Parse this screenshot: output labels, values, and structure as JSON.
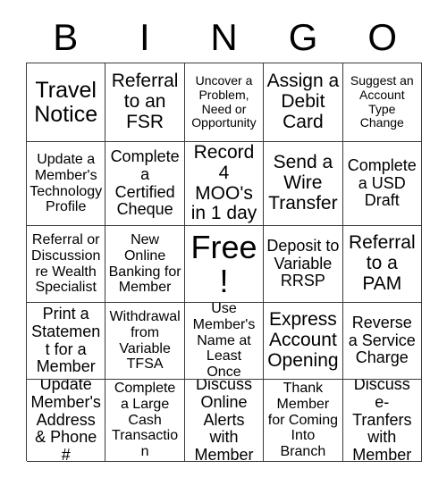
{
  "card": {
    "header_letters": [
      "B",
      "I",
      "N",
      "G",
      "O"
    ],
    "rows": [
      [
        {
          "text": "Travel Notice",
          "size": "fs-xl"
        },
        {
          "text": "Referral to an FSR",
          "size": "fs-lg"
        },
        {
          "text": "Uncover a Problem, Need or Opportunity",
          "size": "fs-xs"
        },
        {
          "text": "Assign a Debit Card",
          "size": "fs-lg"
        },
        {
          "text": "Suggest an Account Type Change",
          "size": "fs-xs"
        }
      ],
      [
        {
          "text": "Update a Member's Technology Profile",
          "size": "fs-sm"
        },
        {
          "text": "Complete a Certified Cheque",
          "size": "fs-md"
        },
        {
          "text": "Record 4 MOO's in 1 day",
          "size": "fs-lg"
        },
        {
          "text": "Send a Wire Transfer",
          "size": "fs-lg"
        },
        {
          "text": "Complete a USD Draft",
          "size": "fs-md"
        }
      ],
      [
        {
          "text": "Referral or Discussion re Wealth Specialist",
          "size": "fs-sm"
        },
        {
          "text": "New Online Banking for Member",
          "size": "fs-sm"
        },
        {
          "text": "Free!",
          "size": "fs-xxl"
        },
        {
          "text": "Deposit to Variable RRSP",
          "size": "fs-md"
        },
        {
          "text": "Referral to a PAM",
          "size": "fs-lg"
        }
      ],
      [
        {
          "text": "Print a Statement for a Member",
          "size": "fs-md"
        },
        {
          "text": "Withdrawal from Variable TFSA",
          "size": "fs-sm"
        },
        {
          "text": "Use Member's Name at Least Once",
          "size": "fs-sm"
        },
        {
          "text": "Express Account Opening",
          "size": "fs-lg"
        },
        {
          "text": "Reverse a Service Charge",
          "size": "fs-md"
        }
      ],
      [
        {
          "text": "Update Member's Address & Phone #",
          "size": "fs-md"
        },
        {
          "text": "Complete a Large Cash Transaction",
          "size": "fs-sm"
        },
        {
          "text": "Discuss Online Alerts with Member",
          "size": "fs-md"
        },
        {
          "text": "Thank Member for Coming Into Branch",
          "size": "fs-sm"
        },
        {
          "text": "Discuss e-Tranfers with Member",
          "size": "fs-md"
        }
      ]
    ]
  },
  "colors": {
    "background": "#ffffff",
    "text": "#000000",
    "grid_line": "#3a3a3a"
  }
}
